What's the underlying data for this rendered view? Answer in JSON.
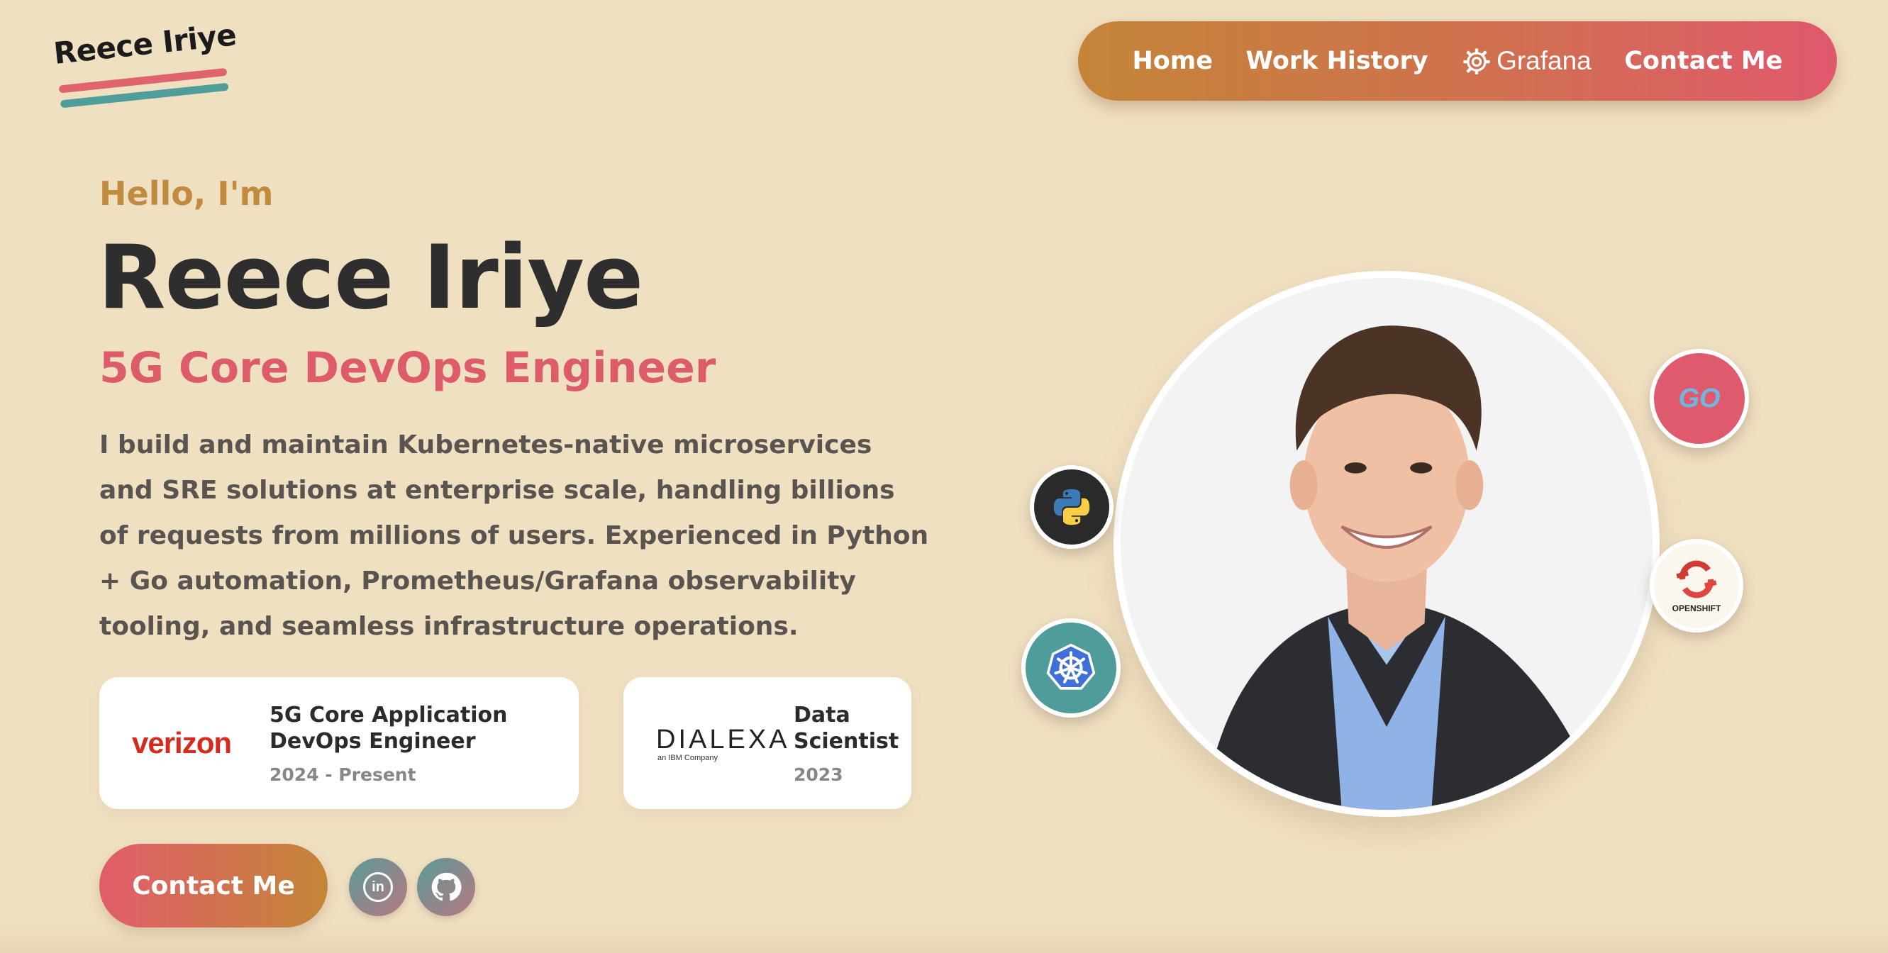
{
  "logo": {
    "text": "Reece Iriye"
  },
  "nav": {
    "items": [
      {
        "label": "Home"
      },
      {
        "label": "Work History"
      },
      {
        "label": "Grafana"
      },
      {
        "label": "Contact Me"
      }
    ]
  },
  "hero": {
    "greeting": "Hello, I'm",
    "name": "Reece Iriye",
    "role": "5G Core DevOps Engineer",
    "bio": "I build and maintain Kubernetes-native microservices and SRE solutions at enterprise scale, handling billions of requests from millions of users. Experienced in Python + Go automation, Prometheus/Grafana observability tooling, and seamless infrastructure operations."
  },
  "jobs": [
    {
      "company": "verizon",
      "title_line1": "5G Core Application",
      "title_line2": "DevOps Engineer",
      "dates": "2024 - Present"
    },
    {
      "company": "DIALEXA",
      "company_sub": "an IBM Company",
      "title_line1": "Data",
      "title_line2": "Scientist",
      "dates": "2023"
    }
  ],
  "cta": {
    "label": "Contact Me"
  },
  "socials": [
    {
      "icon": "linkedin-icon",
      "glyph": "in"
    },
    {
      "icon": "github-icon"
    }
  ],
  "tech_badges": [
    {
      "icon": "go-icon",
      "text": "GO"
    },
    {
      "icon": "python-icon"
    },
    {
      "icon": "openshift-icon",
      "text": "OPENSHIFT"
    },
    {
      "icon": "kubernetes-icon"
    }
  ],
  "colors": {
    "background": "#f0e0c2",
    "accent_pink": "#dd5c6c",
    "accent_gold": "#c28a3e",
    "accent_teal": "#4f9e9a"
  }
}
